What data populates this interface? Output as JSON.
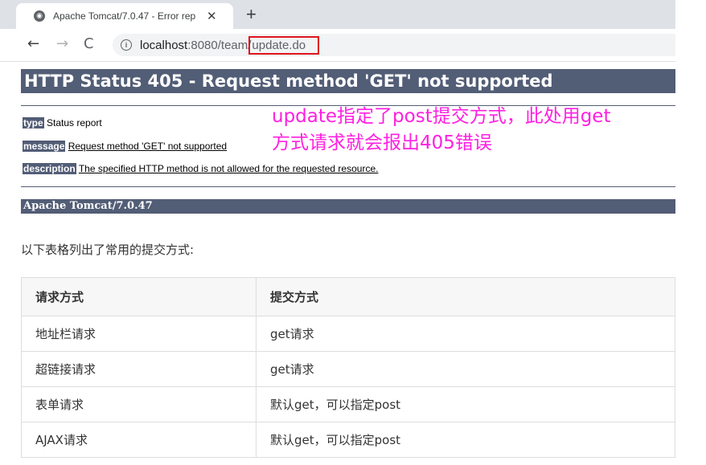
{
  "browser": {
    "tab_title": "Apache Tomcat/7.0.47 - Error rep",
    "tab_close": "✕",
    "new_tab": "+",
    "back": "←",
    "forward": "→",
    "reload": "C",
    "url_host": "localhost",
    "url_port_path": ":8080/team/",
    "url_highlight": "update.do"
  },
  "error_page": {
    "heading": "HTTP Status 405 - Request method 'GET' not supported",
    "type_label": "type",
    "type_value": "Status report",
    "message_label": "message",
    "message_value": "Request method 'GET' not supported",
    "description_label": "description",
    "description_value": "The specified HTTP method is not allowed for the requested resource.",
    "footer": "Apache Tomcat/7.0.47"
  },
  "annotation": {
    "line1": "update指定了post提交方式，此处用get",
    "line2": "方式请求就会报出405错误",
    "color": "#ff1fe0"
  },
  "content": {
    "intro": "以下表格列出了常用的提交方式:",
    "table": {
      "headers": [
        "请求方式",
        "提交方式"
      ],
      "rows": [
        [
          "地址栏请求",
          "get请求"
        ],
        [
          "超链接请求",
          "get请求"
        ],
        [
          "表单请求",
          "默认get，可以指定post"
        ],
        [
          "AJAX请求",
          "默认get，可以指定post"
        ]
      ]
    }
  },
  "colors": {
    "tomcat_bar": "#525d76",
    "url_highlight_box": "#e0141e"
  }
}
